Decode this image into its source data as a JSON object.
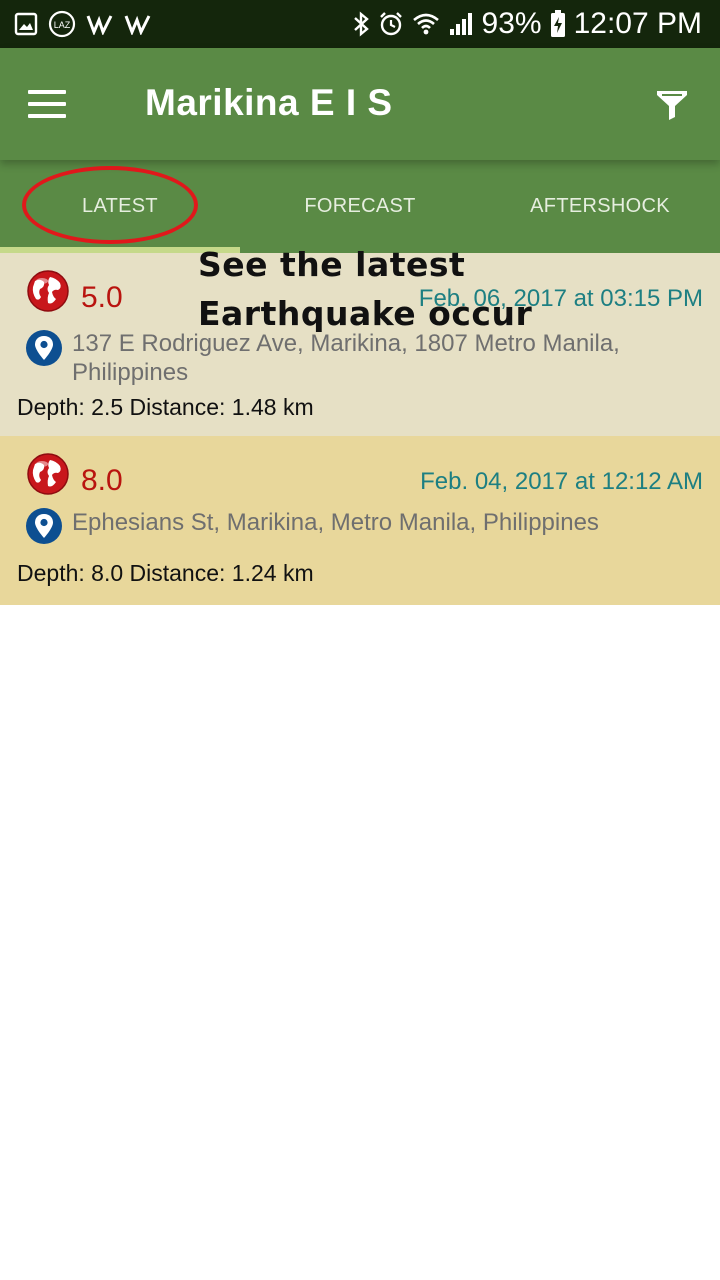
{
  "status_bar": {
    "battery": "93%",
    "time": "12:07 PM",
    "icons": [
      "image-icon",
      "laz-icon",
      "w-icon",
      "w-icon",
      "bluetooth-icon",
      "alarm-icon",
      "wifi-icon",
      "signal-icon",
      "battery-charging-icon"
    ]
  },
  "app_bar": {
    "title": "Marikina E I S",
    "menu_icon": "hamburger-menu-icon",
    "filter_icon": "filter-icon"
  },
  "tabs": [
    {
      "label": "LATEST",
      "active": true
    },
    {
      "label": "FORECAST",
      "active": false
    },
    {
      "label": "AFTERSHOCK",
      "active": false
    }
  ],
  "annotation": {
    "text": "See the latest\nEarthquake occur",
    "color": "#e0181b"
  },
  "earthquakes": [
    {
      "magnitude": "5.0",
      "date": "Feb. 06, 2017 at 03:15 PM",
      "address": "137 E Rodriguez Ave, Marikina, 1807 Metro Manila, Philippines",
      "details": "Depth: 2.5 Distance: 1.48 km",
      "background": "#e6e0c5"
    },
    {
      "magnitude": "8.0",
      "date": "Feb. 04, 2017 at 12:12 AM",
      "address": "Ephesians St, Marikina, Metro Manila, Philippines",
      "details": "Depth: 8.0 Distance: 1.24 km",
      "background": "#e8d79b"
    }
  ],
  "colors": {
    "status_bar": "#14260c",
    "primary": "#5a8a45",
    "tab_indicator": "#c5d98a",
    "magnitude": "#b9140f",
    "date": "#1d7f82",
    "address": "#6f6f6f",
    "pin": "#0d4f91"
  }
}
